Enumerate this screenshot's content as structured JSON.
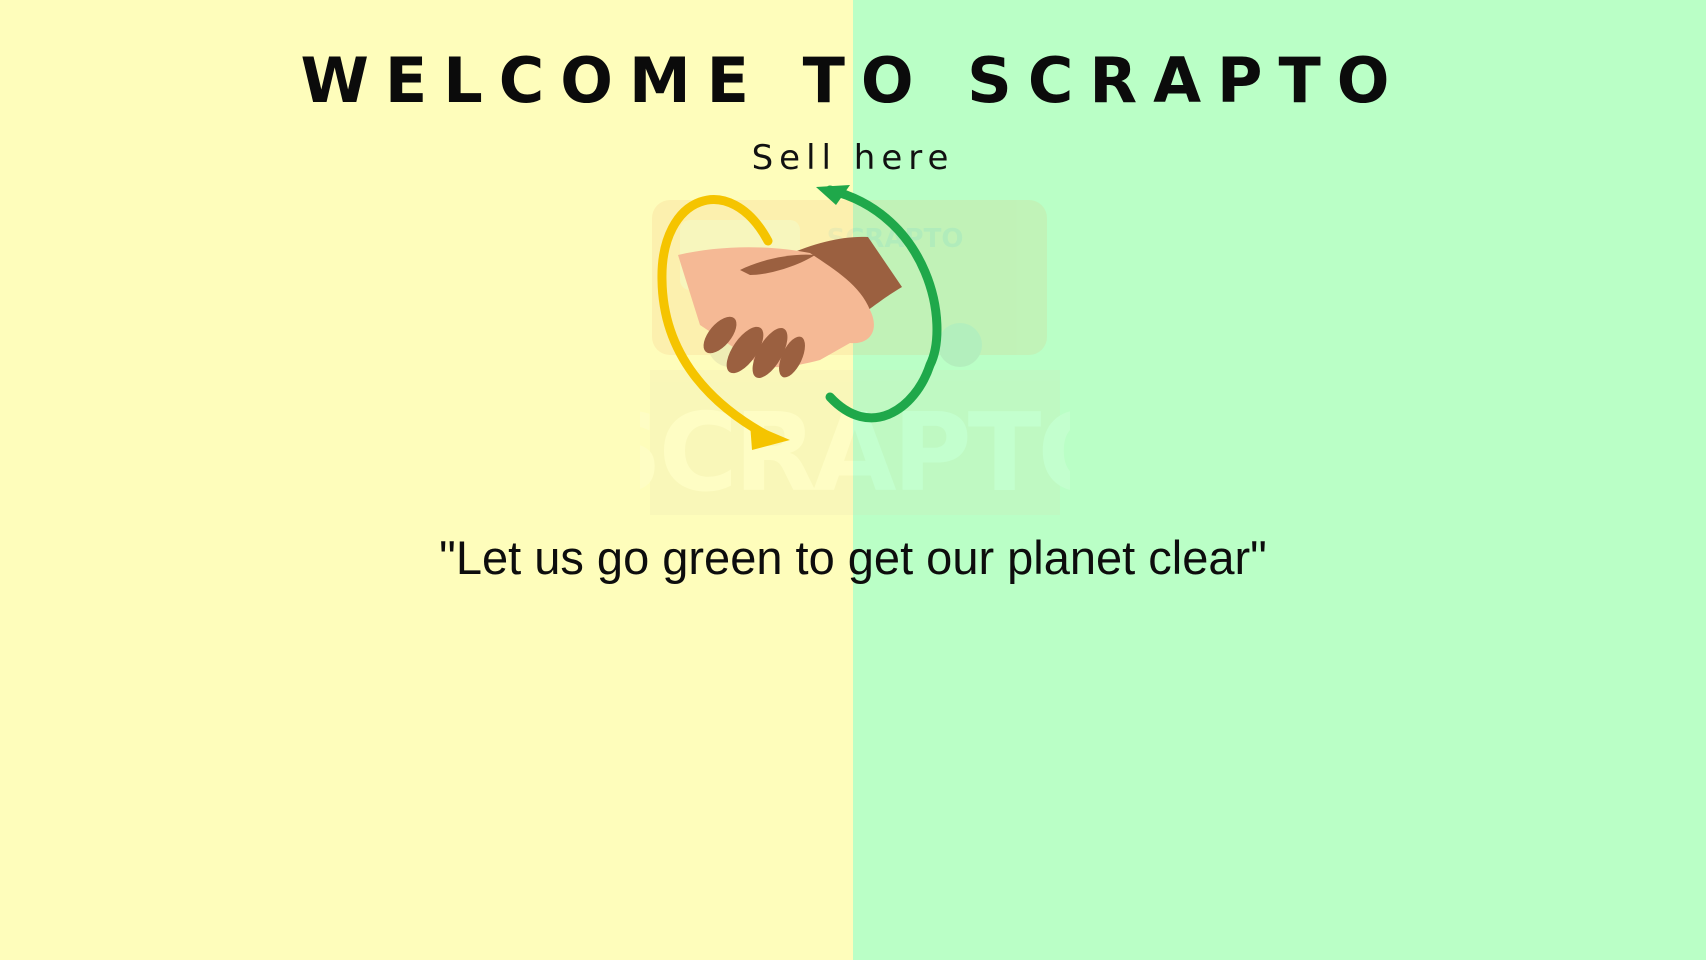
{
  "background": {
    "left_color": "#fefdbb",
    "right_color": "#baffc6"
  },
  "header": {
    "title": "WELCOME TO SCRAPTO",
    "subtitle_link": "Sell here"
  },
  "logo": {
    "icon": "handshake-recycle-icon",
    "watermark_text": "SCRAPTO",
    "watermark_small_text": "SCRAPTO",
    "colors": {
      "yellow_arrow": "#f5c400",
      "green_arrow": "#1fa84a",
      "light_hand": "#f5b995",
      "dark_hand": "#9b6040"
    }
  },
  "main": {
    "quote": "\"Let us go green to get our planet clear\""
  }
}
